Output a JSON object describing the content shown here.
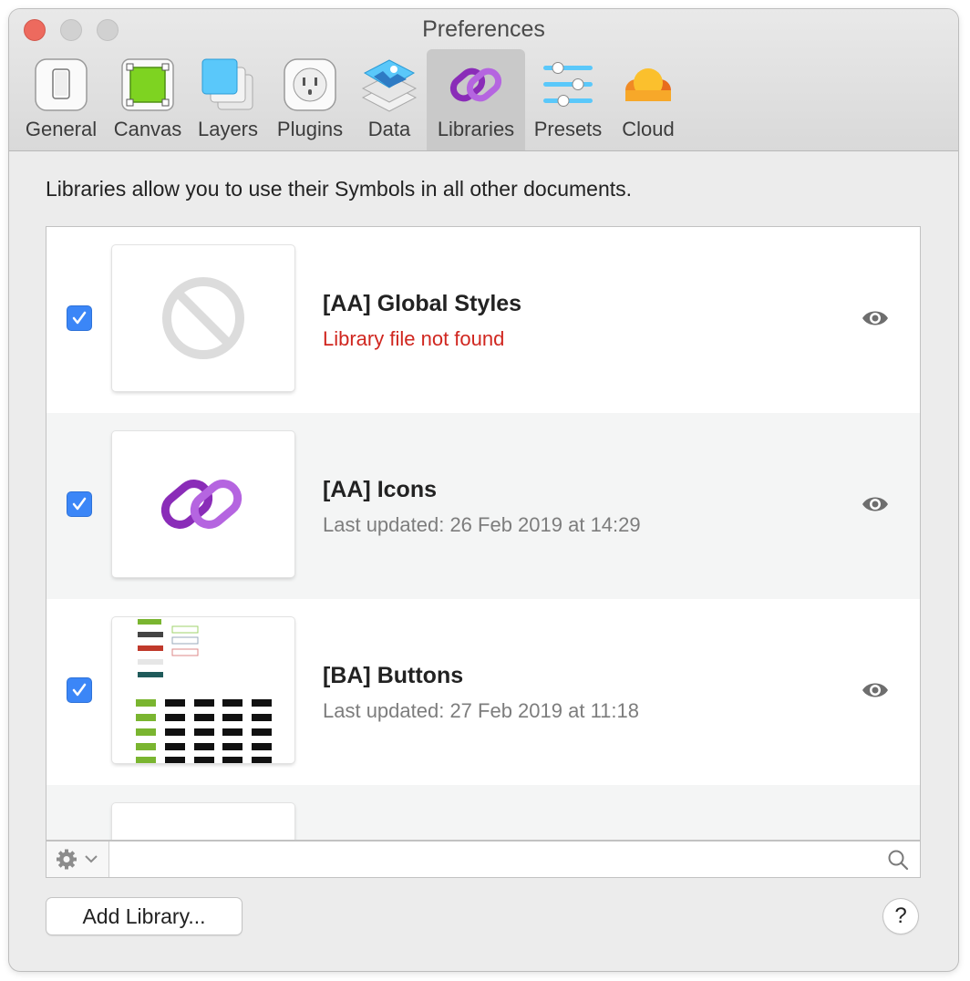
{
  "window": {
    "title": "Preferences"
  },
  "toolbar": {
    "tabs": [
      {
        "label": "General"
      },
      {
        "label": "Canvas"
      },
      {
        "label": "Layers"
      },
      {
        "label": "Plugins"
      },
      {
        "label": "Data"
      },
      {
        "label": "Libraries",
        "selected": true
      },
      {
        "label": "Presets"
      },
      {
        "label": "Cloud"
      }
    ]
  },
  "main": {
    "description": "Libraries allow you to use their Symbols in all other documents.",
    "libraries": [
      {
        "name": "[AA] Global Styles",
        "status": "Library file not found",
        "checked": true,
        "error": true,
        "thumbnail": "no-entry-icon"
      },
      {
        "name": "[AA] Icons",
        "status": "Last updated: 26 Feb 2019 at 14:29",
        "checked": true,
        "thumbnail": "link-icon"
      },
      {
        "name": "[BA] Buttons",
        "status": "Last updated: 27 Feb 2019 at 11:18",
        "checked": true,
        "thumbnail": "buttons-preview"
      }
    ]
  },
  "footer": {
    "add_library_label": "Add Library...",
    "help_label": "?"
  },
  "colors": {
    "accent": "#3b86f7",
    "error": "#d0261f",
    "libraries_purple": "#9b3cc7"
  }
}
